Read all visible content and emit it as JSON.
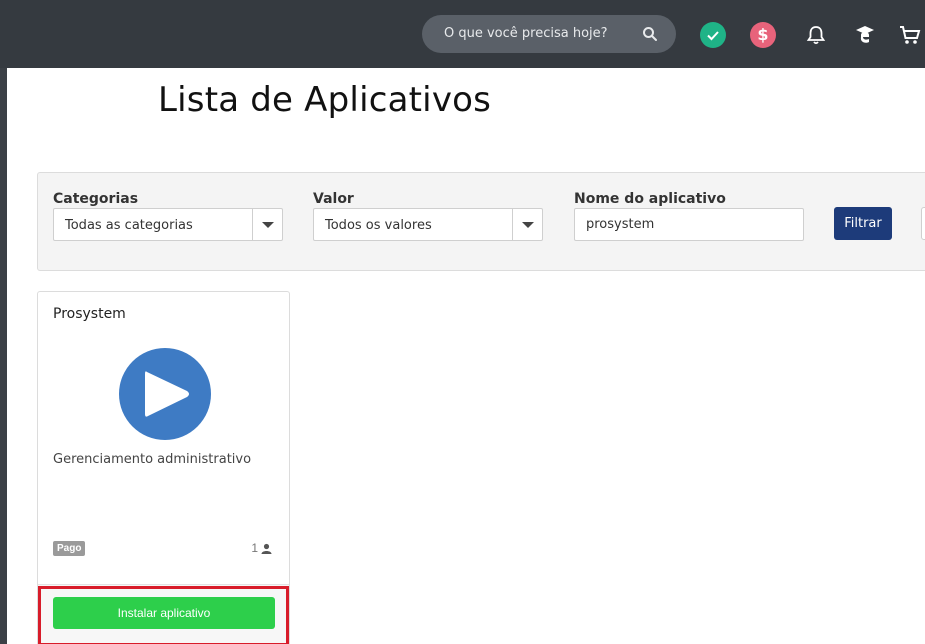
{
  "header": {
    "search_placeholder": "O que você precisa hoje?",
    "icons": [
      "search-icon",
      "check-circle-icon",
      "dollar-circle-icon",
      "bell-icon",
      "education-icon",
      "cart-icon"
    ],
    "money_symbol": "$"
  },
  "page": {
    "title": "Lista de Aplicativos"
  },
  "filters": {
    "category_label": "Categorias",
    "category_value": "Todas as categorias",
    "value_label": "Valor",
    "value_value": "Todos os valores",
    "name_label": "Nome do aplicativo",
    "name_value": "prosystem",
    "filter_button": "Filtrar"
  },
  "apps": [
    {
      "name": "Prosystem",
      "description": "Gerenciamento administrativo",
      "price_badge": "Pago",
      "user_count": "1",
      "install_label": "Instalar aplicativo"
    }
  ],
  "colors": {
    "topbar": "#353a40",
    "accent_blue": "#1d3b7a",
    "install_green": "#2dcf4b",
    "play_blue": "#3e7bc4",
    "highlight_red": "#d81c2a"
  }
}
